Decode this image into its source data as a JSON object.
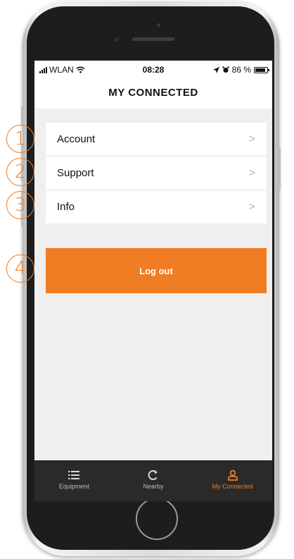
{
  "status_bar": {
    "carrier": "WLAN",
    "time": "08:28",
    "battery_text": "86 %",
    "battery_level": 0.86
  },
  "header": {
    "title": "MY CONNECTED"
  },
  "menu": {
    "items": [
      {
        "label": "Account",
        "chevron": ">"
      },
      {
        "label": "Support",
        "chevron": ">"
      },
      {
        "label": "Info",
        "chevron": ">"
      }
    ]
  },
  "logout": {
    "label": "Log out"
  },
  "tabs": [
    {
      "label": "Equipment",
      "icon": "list-icon",
      "active": false
    },
    {
      "label": "Nearby",
      "icon": "refresh-arrow-icon",
      "active": false
    },
    {
      "label": "My Connected",
      "icon": "user-icon",
      "active": true
    }
  ],
  "annotations": [
    "1",
    "2",
    "3",
    "4"
  ],
  "colors": {
    "accent": "#f07d23",
    "tab_bar": "#2a2a2a",
    "screen_bg": "#efefef"
  }
}
